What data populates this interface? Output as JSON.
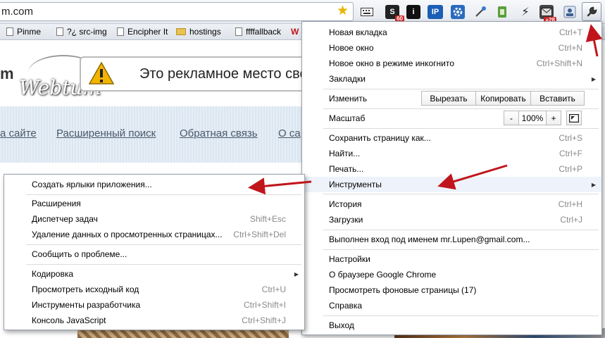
{
  "omnibox": {
    "url": "m.com"
  },
  "toolbar": {
    "extensions": [
      {
        "icon": "keyboard-icon",
        "label": ""
      },
      {
        "icon": "sl-badge-icon",
        "label": "S",
        "badge": "60"
      },
      {
        "icon": "info-icon",
        "label": "i"
      },
      {
        "icon": "ip-icon",
        "label": "IP"
      },
      {
        "icon": "settings-ext-icon",
        "label": ""
      },
      {
        "icon": "eyedropper-icon",
        "label": ""
      },
      {
        "icon": "evernote-icon",
        "label": ""
      },
      {
        "icon": "lightning-icon",
        "label": ""
      },
      {
        "icon": "mail-badge-icon",
        "label": "",
        "badge": "+28"
      },
      {
        "icon": "profile-icon",
        "label": ""
      }
    ]
  },
  "bookmarks": [
    {
      "icon": "page-icon",
      "label": "Pinme"
    },
    {
      "icon": "page-icon",
      "label": "?¿ src-img"
    },
    {
      "icon": "page-icon",
      "label": "Encipher It"
    },
    {
      "icon": "folder-icon",
      "label": "hostings"
    },
    {
      "icon": "page-icon",
      "label": "ffffallback"
    },
    {
      "icon": "w-icon",
      "label": "W"
    }
  ],
  "page": {
    "logo_left": "m",
    "logo_text": "Webtum",
    "ad_text": "Это рекламное место сво",
    "nav_links": [
      "а сайте",
      "Расширенный поиск",
      "Обратная связь",
      "О са"
    ]
  },
  "main_menu": {
    "new_tab": {
      "label": "Новая вкладка",
      "shortcut": "Ctrl+T"
    },
    "new_window": {
      "label": "Новое окно",
      "shortcut": "Ctrl+N"
    },
    "incognito": {
      "label": "Новое окно в режиме инкогнито",
      "shortcut": "Ctrl+Shift+N"
    },
    "bookmarks": {
      "label": "Закладки"
    },
    "edit": {
      "label": "Изменить",
      "cut": "Вырезать",
      "copy": "Копировать",
      "paste": "Вставить"
    },
    "zoom": {
      "label": "Масштаб",
      "minus": "-",
      "value": "100%",
      "plus": "+"
    },
    "save_page": {
      "label": "Сохранить страницу как...",
      "shortcut": "Ctrl+S"
    },
    "find": {
      "label": "Найти...",
      "shortcut": "Ctrl+F"
    },
    "print": {
      "label": "Печать...",
      "shortcut": "Ctrl+P"
    },
    "tools": {
      "label": "Инструменты"
    },
    "history": {
      "label": "История",
      "shortcut": "Ctrl+H"
    },
    "downloads": {
      "label": "Загрузки",
      "shortcut": "Ctrl+J"
    },
    "signed_in": {
      "label": "Выполнен вход под именем mr.Lupen@gmail.com..."
    },
    "settings": {
      "label": "Настройки"
    },
    "about": {
      "label": "О браузере Google Chrome"
    },
    "background_pages": {
      "label": "Просмотреть фоновые страницы (17)"
    },
    "help": {
      "label": "Справка"
    },
    "exit": {
      "label": "Выход"
    }
  },
  "tools_menu": {
    "create_shortcuts": {
      "label": "Создать ярлыки приложения..."
    },
    "extensions": {
      "label": "Расширения"
    },
    "task_manager": {
      "label": "Диспетчер задач",
      "shortcut": "Shift+Esc"
    },
    "clear_data": {
      "label": "Удаление данных о просмотренных страницах...",
      "shortcut": "Ctrl+Shift+Del"
    },
    "report_issue": {
      "label": "Сообщить о проблеме..."
    },
    "encoding": {
      "label": "Кодировка"
    },
    "view_source": {
      "label": "Просмотреть исходный код",
      "shortcut": "Ctrl+U"
    },
    "dev_tools": {
      "label": "Инструменты разработчика",
      "shortcut": "Ctrl+Shift+I"
    },
    "js_console": {
      "label": "Консоль JavaScript",
      "shortcut": "Ctrl+Shift+J"
    }
  },
  "colors": {
    "annotation_arrow": "#c0161b",
    "highlight": "#eef3fb",
    "star": "#e8b400"
  }
}
